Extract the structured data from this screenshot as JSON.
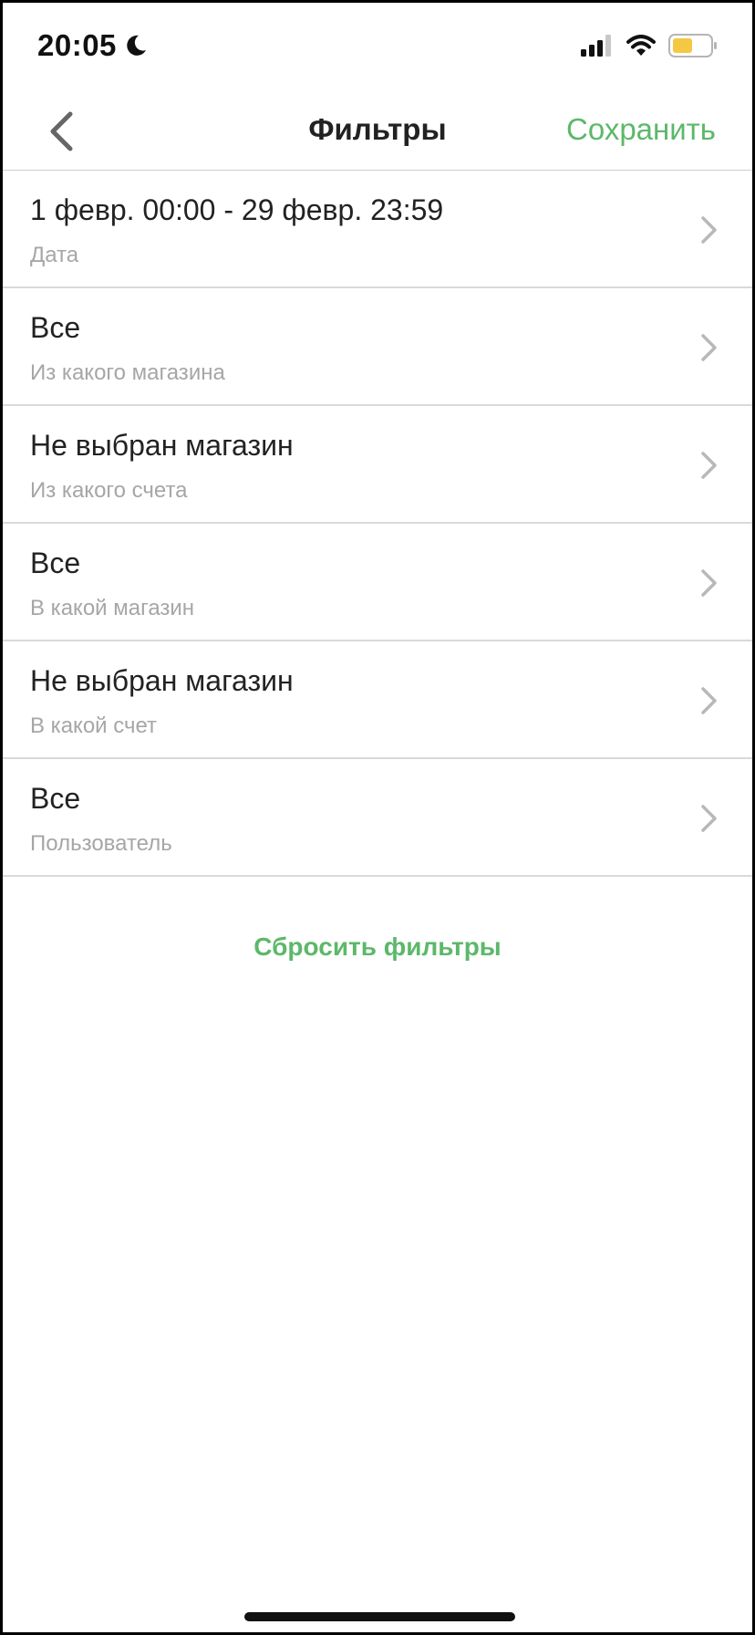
{
  "status": {
    "time": "20:05"
  },
  "nav": {
    "title": "Фильтры",
    "save_label": "Сохранить"
  },
  "filters": [
    {
      "value": "1 февр. 00:00 - 29 февр. 23:59",
      "label": "Дата"
    },
    {
      "value": "Все",
      "label": "Из какого магазина"
    },
    {
      "value": "Не выбран магазин",
      "label": "Из какого счета"
    },
    {
      "value": "Все",
      "label": "В какой магазин"
    },
    {
      "value": "Не выбран магазин",
      "label": "В какой счет"
    },
    {
      "value": "Все",
      "label": "Пользователь"
    }
  ],
  "reset_label": "Сбросить фильтры",
  "colors": {
    "accent": "#5cb86a",
    "battery": "#f5c842"
  },
  "icons": [
    "moon-icon",
    "cellular-signal-icon",
    "wifi-icon",
    "battery-icon",
    "back-chevron-icon",
    "chevron-right-icon"
  ]
}
